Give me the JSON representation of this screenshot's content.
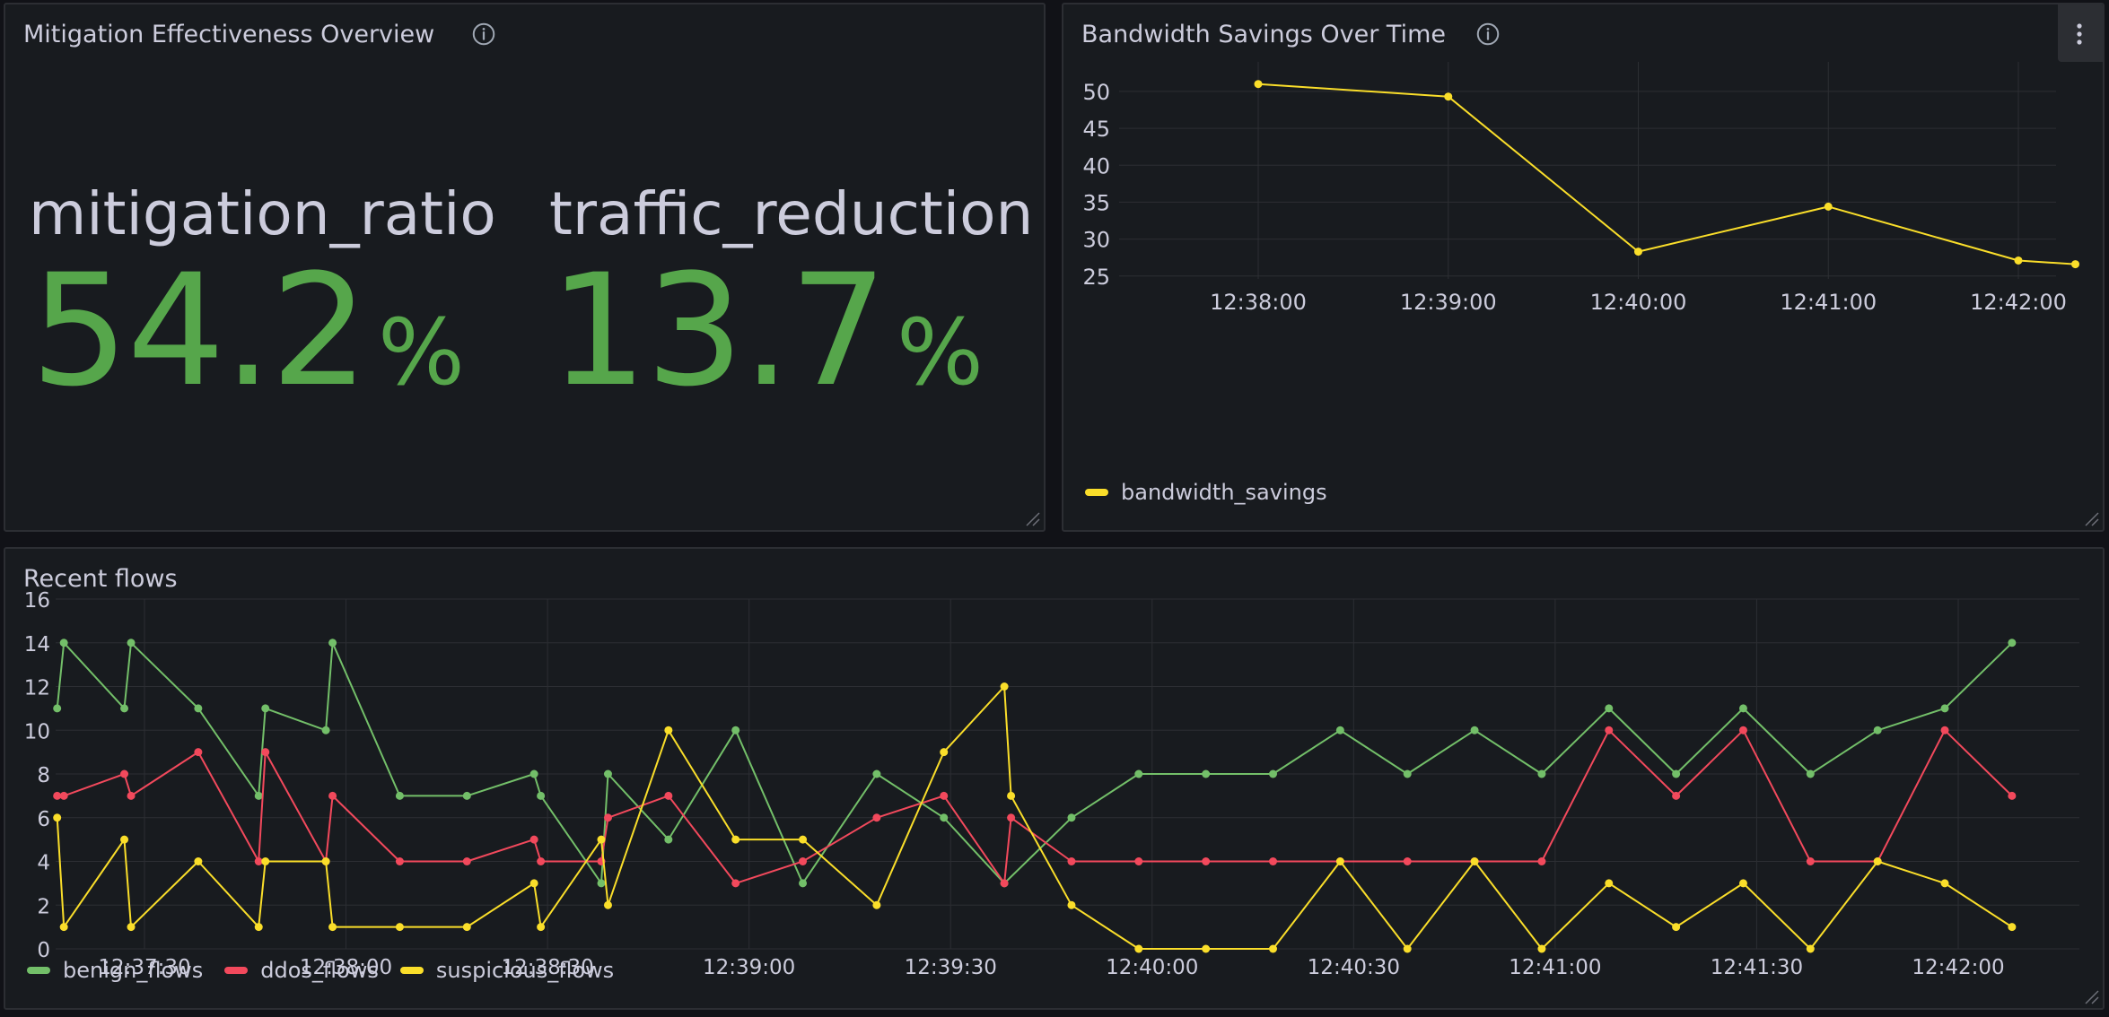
{
  "panels": {
    "mitigation": {
      "title": "Mitigation Effectiveness Overview",
      "stats": [
        {
          "name": "mitigation_ratio",
          "value": "54.2",
          "unit": "%"
        },
        {
          "name": "traffic_reduction",
          "value": "13.7",
          "unit": "%"
        }
      ]
    },
    "bandwidth": {
      "title": "Bandwidth Savings Over Time"
    },
    "flows": {
      "title": "Recent flows"
    }
  },
  "colors": {
    "green": "#73bf69",
    "red": "#f2495c",
    "yellow": "#fade2a",
    "stat_green": "#56a64b",
    "grid": "#2c2e33"
  },
  "chart_data": [
    {
      "type": "line",
      "title": "Bandwidth Savings Over Time",
      "x_tick_labels": [
        "12:38:00",
        "12:39:00",
        "12:40:00",
        "12:41:00",
        "12:42:00"
      ],
      "y_ticks": [
        25,
        30,
        35,
        40,
        45,
        50
      ],
      "ylim": [
        24,
        54
      ],
      "series": [
        {
          "name": "bandwidth_savings",
          "color": "#fade2a",
          "points": [
            {
              "x": "12:38:00",
              "y": 51
            },
            {
              "x": "12:39:00",
              "y": 49.3
            },
            {
              "x": "12:40:00",
              "y": 28.3
            },
            {
              "x": "12:41:00",
              "y": 34.4
            },
            {
              "x": "12:42:00",
              "y": 27.1
            },
            {
              "x": "12:42:18",
              "y": 26.6
            }
          ]
        }
      ],
      "legend": "bottom-left",
      "grid": true
    },
    {
      "type": "line",
      "title": "Recent flows",
      "x_tick_labels": [
        "12:37:30",
        "12:38:00",
        "12:38:30",
        "12:39:00",
        "12:39:30",
        "12:40:00",
        "12:40:30",
        "12:41:00",
        "12:41:30",
        "12:42:00"
      ],
      "y_ticks": [
        0,
        2,
        4,
        6,
        8,
        10,
        12,
        14,
        16
      ],
      "ylim": [
        0,
        16
      ],
      "series": [
        {
          "name": "benign_flows",
          "color": "#73bf69",
          "points": [
            {
              "x": "12:37:17",
              "y": 11
            },
            {
              "x": "12:37:18",
              "y": 14
            },
            {
              "x": "12:37:27",
              "y": 11
            },
            {
              "x": "12:37:28",
              "y": 14
            },
            {
              "x": "12:37:38",
              "y": 11
            },
            {
              "x": "12:37:47",
              "y": 7
            },
            {
              "x": "12:37:48",
              "y": 11
            },
            {
              "x": "12:37:57",
              "y": 10
            },
            {
              "x": "12:37:58",
              "y": 14
            },
            {
              "x": "12:38:08",
              "y": 7
            },
            {
              "x": "12:38:18",
              "y": 7
            },
            {
              "x": "12:38:28",
              "y": 8
            },
            {
              "x": "12:38:29",
              "y": 7
            },
            {
              "x": "12:38:38",
              "y": 3
            },
            {
              "x": "12:38:39",
              "y": 8
            },
            {
              "x": "12:38:48",
              "y": 5
            },
            {
              "x": "12:38:58",
              "y": 10
            },
            {
              "x": "12:39:08",
              "y": 3
            },
            {
              "x": "12:39:19",
              "y": 8
            },
            {
              "x": "12:39:29",
              "y": 6
            },
            {
              "x": "12:39:38",
              "y": 3
            },
            {
              "x": "12:39:48",
              "y": 6
            },
            {
              "x": "12:39:58",
              "y": 8
            },
            {
              "x": "12:40:08",
              "y": 8
            },
            {
              "x": "12:40:18",
              "y": 8
            },
            {
              "x": "12:40:28",
              "y": 10
            },
            {
              "x": "12:40:38",
              "y": 8
            },
            {
              "x": "12:40:48",
              "y": 10
            },
            {
              "x": "12:40:58",
              "y": 8
            },
            {
              "x": "12:41:08",
              "y": 11
            },
            {
              "x": "12:41:18",
              "y": 8
            },
            {
              "x": "12:41:28",
              "y": 11
            },
            {
              "x": "12:41:38",
              "y": 8
            },
            {
              "x": "12:41:48",
              "y": 10
            },
            {
              "x": "12:41:58",
              "y": 11
            },
            {
              "x": "12:42:08",
              "y": 14
            }
          ]
        },
        {
          "name": "ddos_flows",
          "color": "#f2495c",
          "points": [
            {
              "x": "12:37:17",
              "y": 7
            },
            {
              "x": "12:37:18",
              "y": 7
            },
            {
              "x": "12:37:27",
              "y": 8
            },
            {
              "x": "12:37:28",
              "y": 7
            },
            {
              "x": "12:37:38",
              "y": 9
            },
            {
              "x": "12:37:47",
              "y": 4
            },
            {
              "x": "12:37:48",
              "y": 9
            },
            {
              "x": "12:37:57",
              "y": 4
            },
            {
              "x": "12:37:58",
              "y": 7
            },
            {
              "x": "12:38:08",
              "y": 4
            },
            {
              "x": "12:38:18",
              "y": 4
            },
            {
              "x": "12:38:28",
              "y": 5
            },
            {
              "x": "12:38:29",
              "y": 4
            },
            {
              "x": "12:38:38",
              "y": 4
            },
            {
              "x": "12:38:39",
              "y": 6
            },
            {
              "x": "12:38:48",
              "y": 7
            },
            {
              "x": "12:38:58",
              "y": 3
            },
            {
              "x": "12:39:08",
              "y": 4
            },
            {
              "x": "12:39:19",
              "y": 6
            },
            {
              "x": "12:39:29",
              "y": 7
            },
            {
              "x": "12:39:38",
              "y": 3
            },
            {
              "x": "12:39:39",
              "y": 6
            },
            {
              "x": "12:39:48",
              "y": 4
            },
            {
              "x": "12:39:58",
              "y": 4
            },
            {
              "x": "12:40:08",
              "y": 4
            },
            {
              "x": "12:40:18",
              "y": 4
            },
            {
              "x": "12:40:28",
              "y": 4
            },
            {
              "x": "12:40:38",
              "y": 4
            },
            {
              "x": "12:40:48",
              "y": 4
            },
            {
              "x": "12:40:58",
              "y": 4
            },
            {
              "x": "12:41:08",
              "y": 10
            },
            {
              "x": "12:41:18",
              "y": 7
            },
            {
              "x": "12:41:28",
              "y": 10
            },
            {
              "x": "12:41:38",
              "y": 4
            },
            {
              "x": "12:41:48",
              "y": 4
            },
            {
              "x": "12:41:58",
              "y": 10
            },
            {
              "x": "12:42:08",
              "y": 7
            }
          ]
        },
        {
          "name": "suspicious_flows",
          "color": "#fade2a",
          "points": [
            {
              "x": "12:37:17",
              "y": 6
            },
            {
              "x": "12:37:18",
              "y": 1
            },
            {
              "x": "12:37:27",
              "y": 5
            },
            {
              "x": "12:37:28",
              "y": 1
            },
            {
              "x": "12:37:38",
              "y": 4
            },
            {
              "x": "12:37:47",
              "y": 1
            },
            {
              "x": "12:37:48",
              "y": 4
            },
            {
              "x": "12:37:57",
              "y": 4
            },
            {
              "x": "12:37:58",
              "y": 1
            },
            {
              "x": "12:38:08",
              "y": 1
            },
            {
              "x": "12:38:18",
              "y": 1
            },
            {
              "x": "12:38:28",
              "y": 3
            },
            {
              "x": "12:38:29",
              "y": 1
            },
            {
              "x": "12:38:38",
              "y": 5
            },
            {
              "x": "12:38:39",
              "y": 2
            },
            {
              "x": "12:38:48",
              "y": 10
            },
            {
              "x": "12:38:58",
              "y": 5
            },
            {
              "x": "12:39:08",
              "y": 5
            },
            {
              "x": "12:39:19",
              "y": 2
            },
            {
              "x": "12:39:29",
              "y": 9
            },
            {
              "x": "12:39:38",
              "y": 12
            },
            {
              "x": "12:39:39",
              "y": 7
            },
            {
              "x": "12:39:48",
              "y": 2
            },
            {
              "x": "12:39:58",
              "y": 0
            },
            {
              "x": "12:40:08",
              "y": 0
            },
            {
              "x": "12:40:18",
              "y": 0
            },
            {
              "x": "12:40:28",
              "y": 4
            },
            {
              "x": "12:40:38",
              "y": 0
            },
            {
              "x": "12:40:48",
              "y": 4
            },
            {
              "x": "12:40:58",
              "y": 0
            },
            {
              "x": "12:41:08",
              "y": 3
            },
            {
              "x": "12:41:18",
              "y": 1
            },
            {
              "x": "12:41:28",
              "y": 3
            },
            {
              "x": "12:41:38",
              "y": 0
            },
            {
              "x": "12:41:48",
              "y": 4
            },
            {
              "x": "12:41:58",
              "y": 3
            },
            {
              "x": "12:42:08",
              "y": 1
            }
          ]
        }
      ],
      "legend": "bottom-left",
      "grid": true
    }
  ]
}
